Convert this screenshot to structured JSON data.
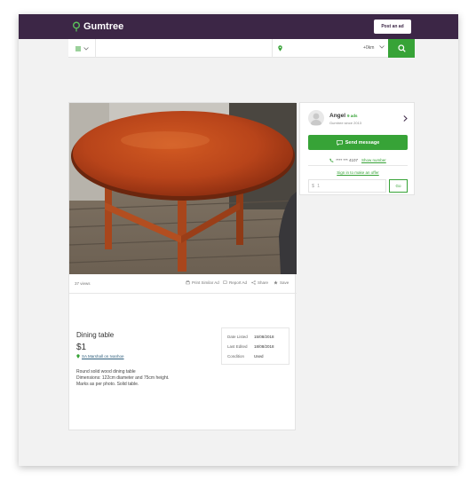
{
  "header": {
    "logo_text": "Gumtree",
    "post_ad_label": "Post an ad",
    "brand_color": "#3c2646",
    "accent_color": "#37a337"
  },
  "search": {
    "category_icon": "category-menu-icon",
    "keyword_value": "",
    "location_value": "",
    "radius_value": "+0km"
  },
  "ad": {
    "views": "37 views",
    "toolbar": {
      "print": "Print Similar Ad",
      "report": "Report Ad",
      "share": "Share",
      "save": "Save"
    },
    "title": "Dining table",
    "price": "$1",
    "location": "SA Marshall on Ivanhoe",
    "description": [
      "Round solid wood dining table",
      "Dimensions: 122cm diameter and 75cm height.",
      "Marks as per photo. Solid table."
    ],
    "details": [
      {
        "key": "Date Listed",
        "value": "15/08/2018"
      },
      {
        "key": "Last Edited",
        "value": "18/08/2018"
      },
      {
        "key": "Condition",
        "value": "Used"
      }
    ]
  },
  "seller": {
    "name": "Angel",
    "ads_count": "9 ads",
    "since": "Gumtree since 2013",
    "send_message_label": "Send message",
    "phone_masked": "**** *** 4107",
    "show_number_label": "Show number",
    "offer_link_label": "Sign in to make an offer",
    "offer_currency": "$",
    "offer_value": "1",
    "offer_go_label": "Go"
  }
}
